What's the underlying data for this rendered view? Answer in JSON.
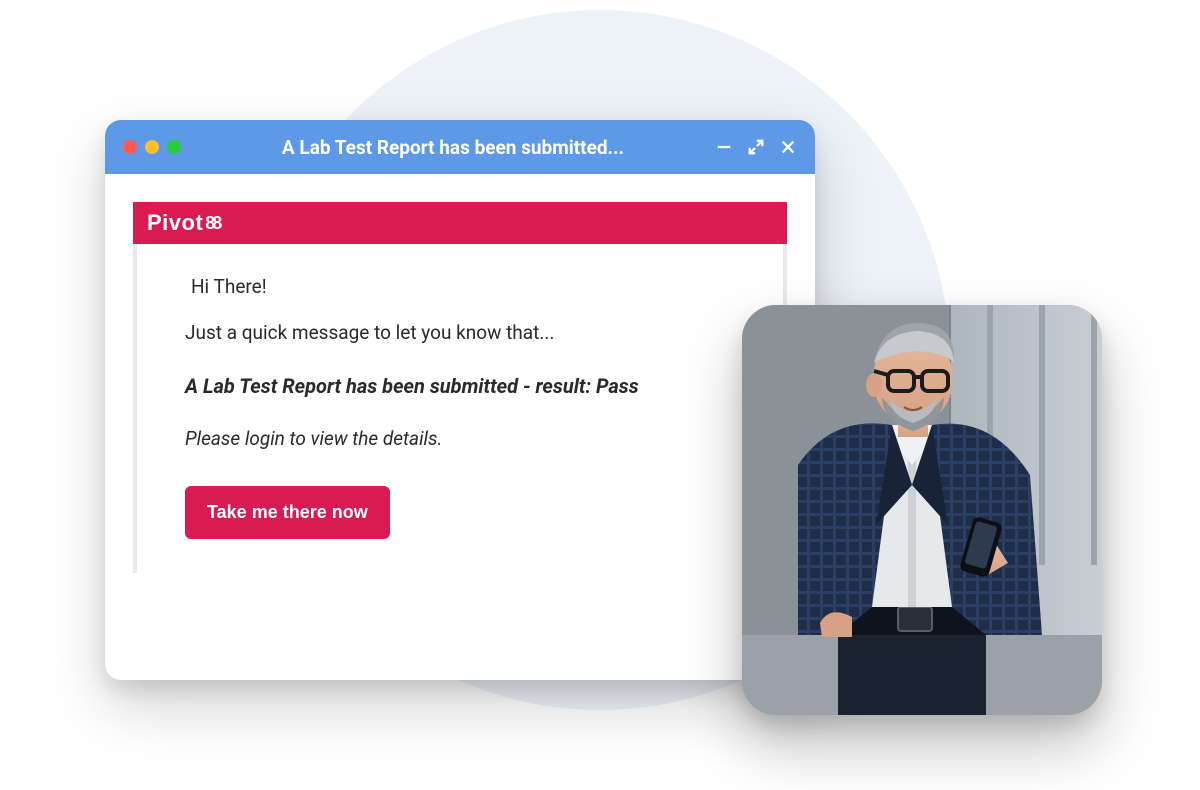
{
  "window": {
    "title": "A Lab Test Report has been submitted...",
    "controls": {
      "close_dot": "close",
      "min_dot": "minimize",
      "max_dot": "zoom",
      "minimize_icon": "minimize",
      "expand_icon": "expand",
      "close_icon": "close"
    }
  },
  "brand": {
    "name": "Pivot",
    "suffix": "88",
    "color": "#d81b50"
  },
  "email": {
    "greeting": "Hi There!",
    "intro": "Just a quick message to let you know that...",
    "headline": "A Lab Test Report has been submitted - result: Pass",
    "instruction": "Please login to view the details.",
    "cta_label": "Take me there now"
  },
  "photo": {
    "alt": "Businessman in plaid blazer looking at smartphone"
  }
}
